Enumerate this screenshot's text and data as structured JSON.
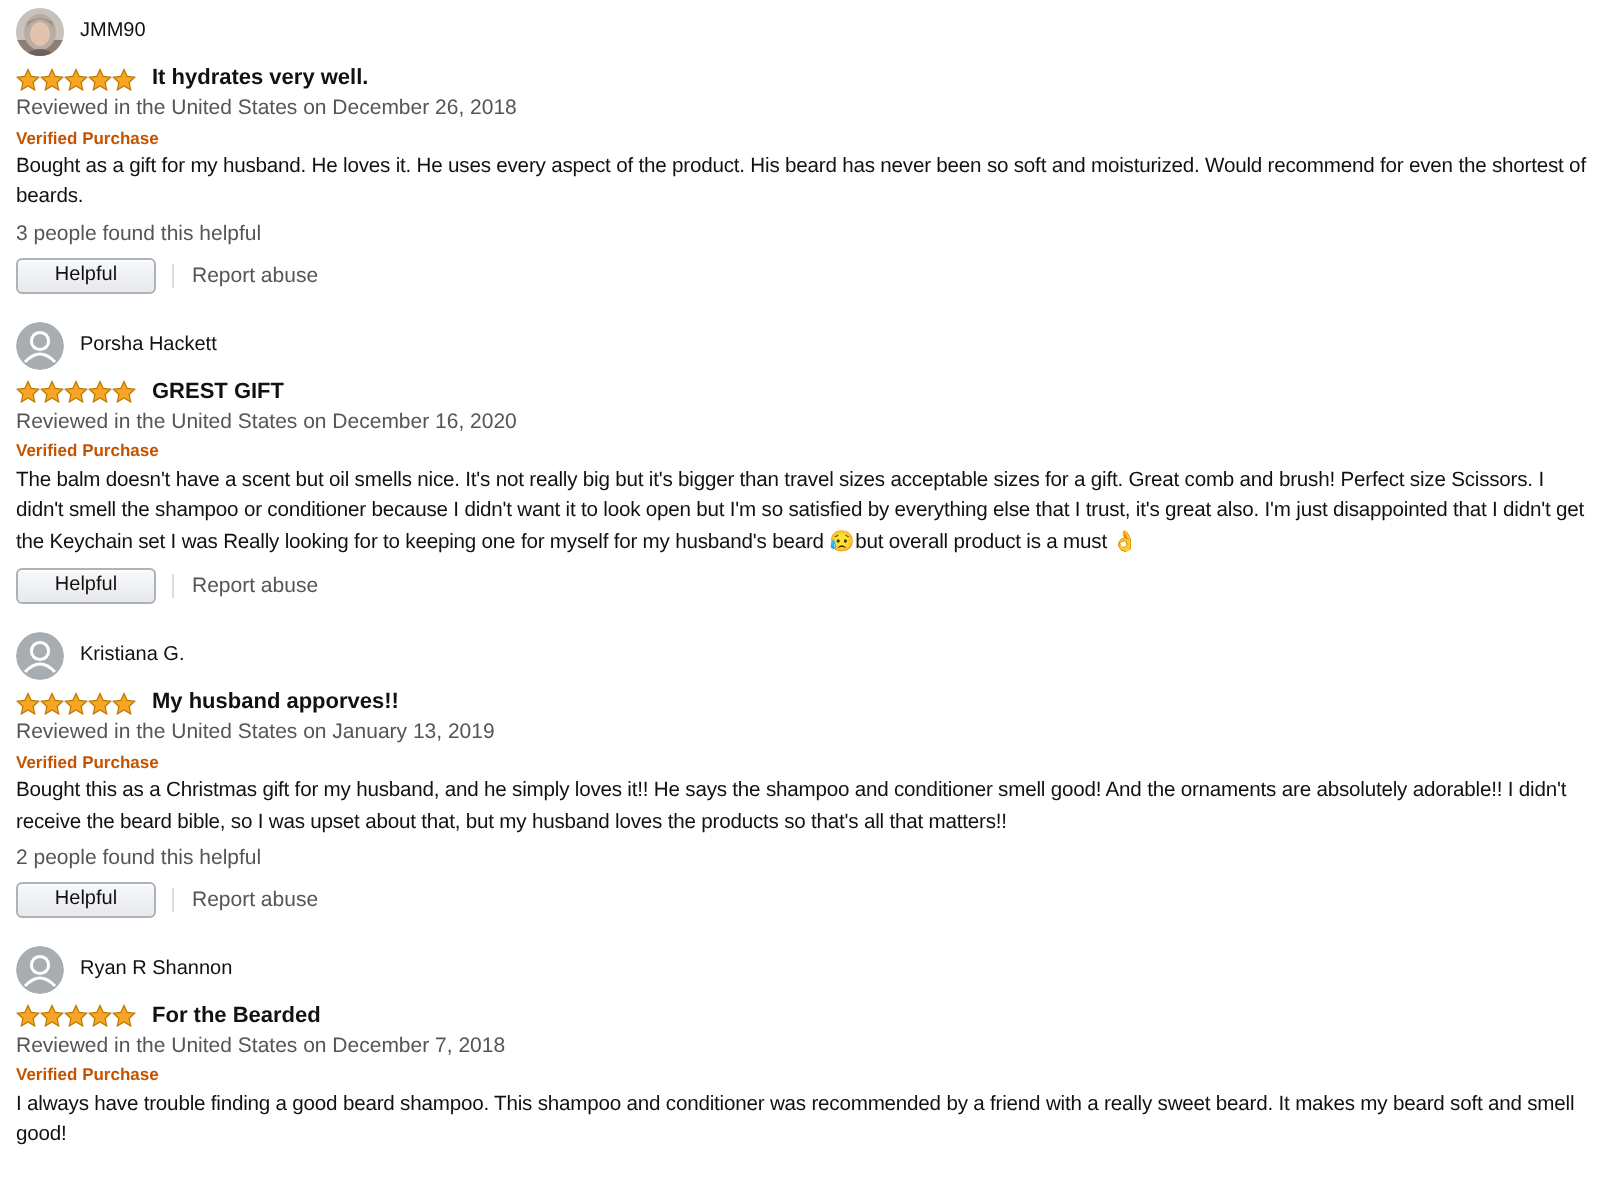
{
  "reviews": [
    {
      "author": "JMM90",
      "stars": 5,
      "title": "It hydrates very well.",
      "date": "Reviewed in the United States on December 26, 2018",
      "badge": "Verified Purchase",
      "body": "Bought as a gift for my husband. He loves it. He uses every aspect of the product. His beard has never been so soft and moisturized. Would recommend for even the shortest of beards.",
      "helpful_count": "3 people found this helpful",
      "actions": {
        "helpful": "Helpful",
        "report": "Report abuse"
      }
    },
    {
      "avatar": {
        "kind": "silhouette"
      },
      "author": "Porsha Hackett",
      "stars": 5,
      "title": "GREST GIFT",
      "date": "Reviewed in the United States on December 16, 2020",
      "badge": "Verified Purchase",
      "body": "The balm doesn't have a scent but oil smells nice. It's not really big but it's bigger than travel sizes acceptable sizes for a gift. Great comb and brush! Perfect size Scissors. I didn't smell the shampoo or conditioner because I didn't want it to look open but I'm so satisfied by everything else that I trust, it's great also. I'm just disappointed that I didn't get the Keychain set I was Really looking for to keeping one for myself for my husband's beard 😥but overall product is a must 👌",
      "actions": {
        "helpful": "Helpful",
        "report": "Report abuse"
      }
    },
    {
      "avatar": {
        "kind": "silhouette"
      },
      "author": "Kristiana G.",
      "stars": 5,
      "title": "My husband apporves!!",
      "date": "Reviewed in the United States on January 13, 2019",
      "badge": "Verified Purchase",
      "body": "Bought this as a Christmas gift for my husband, and he simply loves it!! He says the shampoo and conditioner smell good! And the ornaments are absolutely adorable!! I didn't receive the beard bible, so I was upset about that, but my husband loves the products so that's all that matters!!",
      "helpful_count": "2 people found this helpful",
      "actions": {
        "helpful": "Helpful",
        "report": "Report abuse"
      }
    },
    {
      "avatar": {
        "kind": "silhouette"
      },
      "author": "Ryan R Shannon",
      "stars": 5,
      "title": "For the Bearded",
      "date": "Reviewed in the United States on December 7, 2018",
      "badge": "Verified Purchase",
      "body": "I always have trouble finding a good beard shampoo. This shampoo and conditioner was recommended by a friend with a really sweet beard. It makes my beard soft and smell good!"
    }
  ]
}
